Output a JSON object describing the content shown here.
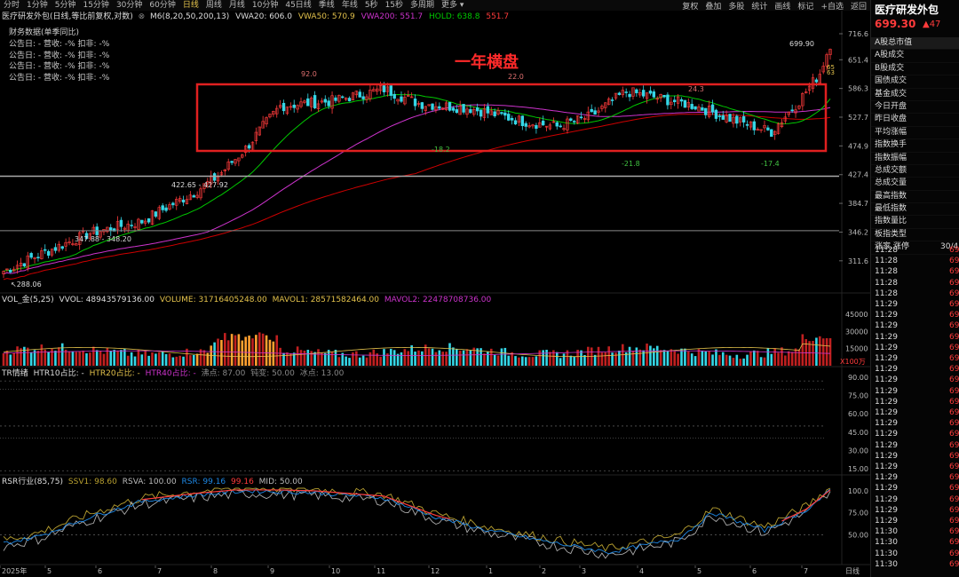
{
  "toolbar": {
    "timeframes": [
      "分时",
      "1分钟",
      "5分钟",
      "15分钟",
      "30分钟",
      "60分钟",
      "日线",
      "周线",
      "月线",
      "10分钟",
      "45日线",
      "季线",
      "年线",
      "5秒",
      "15秒",
      "多周期",
      "更多 ▾"
    ],
    "active_timeframe": "日线",
    "tools": [
      "复权",
      "叠加",
      "多股",
      "统计",
      "画线",
      "标记",
      "+自选",
      "返回"
    ]
  },
  "main_chart": {
    "header_name": "医疗研发外包(日线,等比前复权,对数)",
    "ma_label": "M6(8,20,50,200,13)",
    "vwa20": "VWA20: 606.0",
    "vwa50": "VWA50: 570.9",
    "vwa200": "VWA200: 551.7",
    "hold": "HOLD: 638.8",
    "hold2": "551.7",
    "fin_title": "财务数据(单季同比)",
    "fin_rows": [
      "公告日: -  营收: -%  扣非: -%",
      "公告日: -  营收: -%  扣非: -%",
      "公告日: -  营收: -%  扣非: -%",
      "公告日: -  营收: -%  扣非: -%"
    ],
    "annotation": "一年横盘",
    "price_labels": {
      "high": "699.90",
      "l1": "92.0",
      "l2": "22.0",
      "l3": "24.3",
      "l4": "-18.2",
      "l5": "-21.8",
      "l6": "-17.4",
      "range1": "422.65 - 427.92",
      "range2": "347.88 - 348.20",
      "low": "288.06",
      "side1": "65",
      "side2": "63"
    },
    "y_axis": [
      "716.6",
      "651.4",
      "586.3",
      "527.7",
      "474.9",
      "427.4",
      "384.7",
      "346.2",
      "311.6"
    ]
  },
  "vol_panel": {
    "label": "VOL_金(5,25)",
    "vvol": "VVOL: 48943579136.00",
    "volume": "VOLUME: 31716405248.00",
    "mavol1": "MAVOL1: 28571582464.00",
    "mavol2": "MAVOL2: 22478708736.00",
    "y_axis": [
      "45000",
      "30000",
      "15000"
    ],
    "unit": "X100万"
  },
  "tr_panel": {
    "label": "TR情绪",
    "l1": "HTR10占比: -",
    "l2": "HTR20占比: -",
    "l3": "HTR40占比: -",
    "l4": "沸点: 87.00",
    "l5": "钝变: 50.00",
    "l6": "冰点: 13.00",
    "y_axis": [
      "90.00",
      "75.00",
      "60.00",
      "45.00",
      "30.00",
      "15.00"
    ]
  },
  "rsr_panel": {
    "label": "RSR行业(85,75)",
    "ssv1": "SSV1: 98.60",
    "rsva": "RSVA: 100.00",
    "rsr": "RSR: 99.16",
    "rsr2": "99.16",
    "mid": "MID: 50.00",
    "y_axis": [
      "100.0",
      "75.00",
      "50.00"
    ]
  },
  "x_axis": [
    "2025年",
    "5",
    "6",
    "7",
    "8",
    "9",
    "10",
    "11",
    "12",
    "1",
    "2",
    "3",
    "4",
    "5",
    "6",
    "7"
  ],
  "x_axis_right": "日线",
  "right_panel": {
    "title": "医疗研发外包",
    "price": "699.30",
    "change": "▲47",
    "items": [
      "A股总市值",
      "A股成交",
      "B股成交",
      "国债成交",
      "基金成交",
      "今日开盘",
      "昨日收盘",
      "平均涨幅",
      "指数换手",
      "指数振幅",
      "总成交额",
      "总成交量",
      "最高指数",
      "最低指数",
      "指数量比",
      "板指类型"
    ],
    "special_row": {
      "label": "涨家.涨停",
      "value": "30/4"
    },
    "ticks": [
      {
        "t": "11:28",
        "v": "69"
      },
      {
        "t": "11:28",
        "v": "69"
      },
      {
        "t": "11:28",
        "v": "69"
      },
      {
        "t": "11:28",
        "v": "69"
      },
      {
        "t": "11:28",
        "v": "69"
      },
      {
        "t": "11:29",
        "v": "69"
      },
      {
        "t": "11:29",
        "v": "69"
      },
      {
        "t": "11:29",
        "v": "69"
      },
      {
        "t": "11:29",
        "v": "69"
      },
      {
        "t": "11:29",
        "v": "69"
      },
      {
        "t": "11:29",
        "v": "69"
      },
      {
        "t": "11:29",
        "v": "69"
      },
      {
        "t": "11:29",
        "v": "69"
      },
      {
        "t": "11:29",
        "v": "69"
      },
      {
        "t": "11:29",
        "v": "69"
      },
      {
        "t": "11:29",
        "v": "69"
      },
      {
        "t": "11:29",
        "v": "69"
      },
      {
        "t": "11:29",
        "v": "69"
      },
      {
        "t": "11:29",
        "v": "69"
      },
      {
        "t": "11:29",
        "v": "69"
      },
      {
        "t": "11:29",
        "v": "69"
      },
      {
        "t": "11:29",
        "v": "69"
      },
      {
        "t": "11:29",
        "v": "69"
      },
      {
        "t": "11:29",
        "v": "69"
      },
      {
        "t": "11:29",
        "v": "69"
      },
      {
        "t": "11:29",
        "v": "69"
      },
      {
        "t": "11:30",
        "v": "69"
      },
      {
        "t": "11:30",
        "v": "69"
      },
      {
        "t": "11:30",
        "v": "69"
      },
      {
        "t": "11:30",
        "v": "69"
      }
    ]
  },
  "colors": {
    "up": "#ff3b3b",
    "down": "#35d6e6",
    "ma20": "#00c800",
    "ma50": "#cc33cc",
    "ma200": "#cc0000",
    "box": "#e02020"
  }
}
